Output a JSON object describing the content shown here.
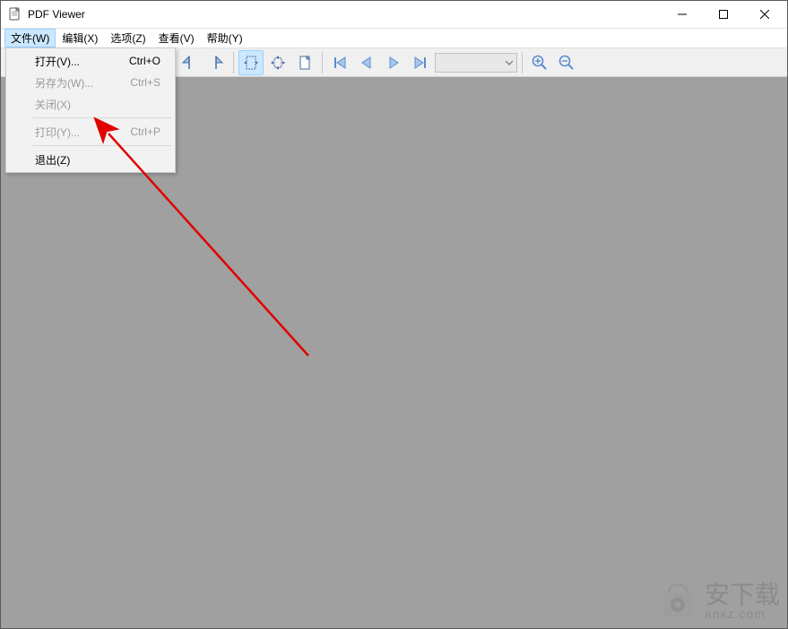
{
  "window": {
    "title": "PDF Viewer"
  },
  "menubar": {
    "file": "文件(W)",
    "edit": "编辑(X)",
    "options": "选项(Z)",
    "view": "查看(V)",
    "help": "帮助(Y)"
  },
  "file_menu": {
    "open": {
      "label": "打开(V)...",
      "shortcut": "Ctrl+O",
      "enabled": true
    },
    "save_as": {
      "label": "另存为(W)...",
      "shortcut": "Ctrl+S",
      "enabled": false
    },
    "close": {
      "label": "关闭(X)",
      "shortcut": "",
      "enabled": false
    },
    "print": {
      "label": "打印(Y)...",
      "shortcut": "Ctrl+P",
      "enabled": false
    },
    "exit": {
      "label": "退出(Z)",
      "shortcut": "",
      "enabled": true
    }
  },
  "toolbar": {
    "rotate_ccw": "rotate-ccw-icon",
    "rotate_cw": "rotate-cw-icon",
    "fit_width": "fit-width-icon",
    "fit_page": "fit-page-icon",
    "single_page": "single-page-icon",
    "first_page": "first-page-icon",
    "prev_page": "prev-page-icon",
    "next_page": "next-page-icon",
    "last_page": "last-page-icon",
    "page_combo": "",
    "zoom_in": "zoom-in-icon",
    "zoom_out": "zoom-out-icon"
  },
  "watermark": {
    "big": "安下载",
    "small": "anxz.com"
  }
}
